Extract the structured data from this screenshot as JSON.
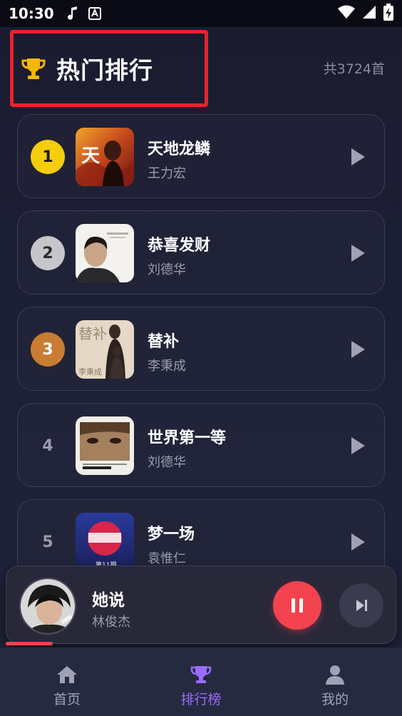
{
  "status_bar": {
    "time": "10:30",
    "icons": [
      "music-note-icon",
      "accessibility-a-icon",
      "wifi-icon",
      "signal-icon",
      "battery-charging-icon"
    ]
  },
  "header": {
    "title": "热门排行",
    "count": "共3724首",
    "icon": "trophy-icon"
  },
  "songs": [
    {
      "rank": "1",
      "title": "天地龙鳞",
      "artist": "王力宏",
      "rank_style": "gold"
    },
    {
      "rank": "2",
      "title": "恭喜发财",
      "artist": "刘德华",
      "rank_style": "silver"
    },
    {
      "rank": "3",
      "title": "替补",
      "artist": "李秉成",
      "rank_style": "bronze"
    },
    {
      "rank": "4",
      "title": "世界第一等",
      "artist": "刘德华",
      "rank_style": "plain"
    },
    {
      "rank": "5",
      "title": "梦一场",
      "artist": "袁惟仁",
      "rank_style": "plain"
    }
  ],
  "cover_texts": {
    "song1": "天",
    "song3": "替补",
    "song3_name": "李秉成",
    "song5_small": "第11期"
  },
  "player": {
    "title": "她说",
    "artist": "林俊杰",
    "progress": 0.12
  },
  "nav": [
    {
      "label": "首页",
      "icon": "home-icon",
      "active": false
    },
    {
      "label": "排行榜",
      "icon": "trophy-icon",
      "active": true
    },
    {
      "label": "我的",
      "icon": "user-icon",
      "active": false
    }
  ],
  "colors": {
    "accent": "#9b6cff",
    "play": "#f2434e",
    "gold": "#f5cd0a",
    "silver": "#c5c5ca",
    "bronze": "#c97d32",
    "highlight_box": "#e8232f"
  }
}
